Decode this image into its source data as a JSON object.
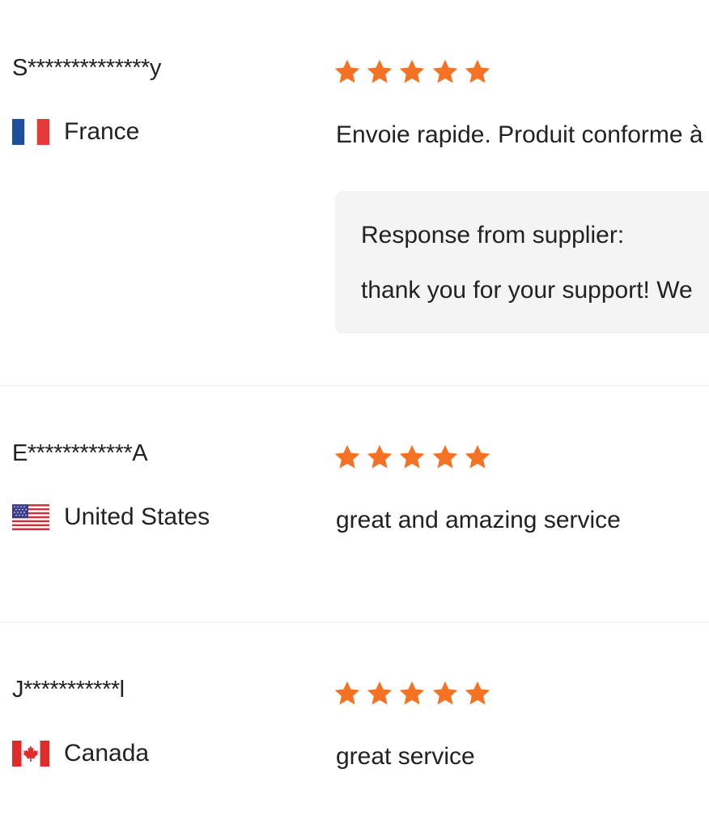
{
  "accent_color": "#f57224",
  "rating_max": 5,
  "reviews": [
    {
      "reviewer": "S**************y",
      "country": "France",
      "flag_icon": "france-flag-icon",
      "rating": 5,
      "text": "Envoie rapide. Produit conforme à",
      "response": {
        "title": "Response from supplier:",
        "text": "thank you for your support! We"
      }
    },
    {
      "reviewer": "E************A",
      "country": "United States",
      "flag_icon": "usa-flag-icon",
      "rating": 5,
      "text": "great and amazing service"
    },
    {
      "reviewer": "J***********l",
      "country": "Canada",
      "flag_icon": "canada-flag-icon",
      "rating": 5,
      "text": "great service"
    }
  ]
}
